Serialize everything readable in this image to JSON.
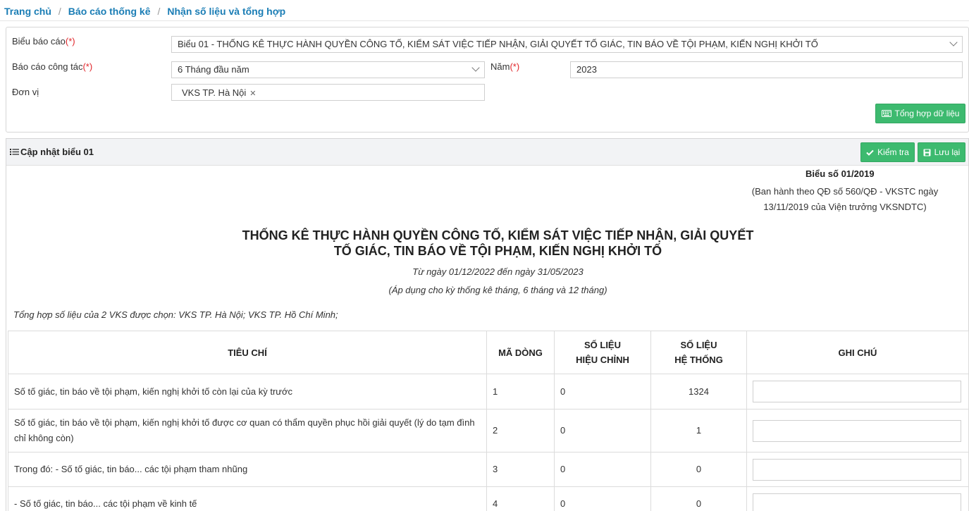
{
  "breadcrumb": [
    "Trang chủ",
    "Báo cáo thống kê",
    "Nhận số liệu và tổng hợp"
  ],
  "filters": {
    "report_form_label": "Biểu báo cáo",
    "required_mark": "(*)",
    "report_form_value": "Biểu 01 - THỐNG KÊ THỰC HÀNH QUYỀN CÔNG TỐ, KIỂM SÁT VIỆC TIẾP NHẬN, GIẢI QUYẾT TỐ GIÁC, TIN BÁO VỀ TỘI PHẠM, KIẾN NGHỊ KHỞI TỐ",
    "period_label": "Báo cáo công tác",
    "period_value": "6 Tháng đầu năm",
    "year_label": "Năm",
    "year_value": "2023",
    "unit_label": "Đơn vị",
    "unit_tags": [
      "VKS TP. Hà Nội"
    ],
    "aggregate_button": "Tổng hợp dữ liệu"
  },
  "update_panel": {
    "title": "Cập nhật biểu 01",
    "check_button": "Kiểm tra",
    "save_button": "Lưu lại"
  },
  "report": {
    "form_no": "Biểu số 01/2019",
    "issued_line1": "(Ban hành theo QĐ số 560/QĐ - VKSTC ngày",
    "issued_line2": "13/11/2019 của Viện trưởng VKSNDTC)",
    "title_line1": "THỐNG KÊ THỰC HÀNH QUYỀN CÔNG TỐ, KIỂM SÁT VIỆC TIẾP NHẬN, GIẢI QUYẾT",
    "title_line2": "TỐ GIÁC, TIN BÁO VỀ TỘI PHẠM, KIẾN NGHỊ KHỞI TỐ",
    "period": "Từ ngày 01/12/2022 đến ngày 31/05/2023",
    "apply": "(Áp dụng cho kỳ thống kê tháng, 6 tháng và 12 tháng)",
    "summary": "Tổng hợp số liệu của 2 VKS được chọn: VKS TP. Hà Nội; VKS TP. Hồ Chí Minh;"
  },
  "table": {
    "headers": {
      "criteria": "TIÊU CHÍ",
      "row_code": "MÃ DÒNG",
      "adjusted_1": "SỐ LIỆU",
      "adjusted_2": "HIỆU CHỈNH",
      "system_1": "SỐ LIỆU",
      "system_2": "HỆ THỐNG",
      "note": "GHI CHÚ"
    },
    "rows": [
      {
        "criteria": "Số tố giác, tin báo về tội phạm, kiến nghị khởi tố còn lại của kỳ trước",
        "code": "1",
        "adjusted": "0",
        "system": "1324",
        "note": ""
      },
      {
        "criteria": "Số tố giác, tin báo về tội phạm, kiến nghị khởi tố được cơ quan có thẩm quyền phục hồi giải quyết (lý do tạm đình chỉ không còn)",
        "code": "2",
        "adjusted": "0",
        "system": "1",
        "note": ""
      },
      {
        "criteria": "Trong đó: - Số tố giác, tin báo... các tội phạm tham nhũng",
        "code": "3",
        "adjusted": "0",
        "system": "0",
        "note": ""
      },
      {
        "criteria": "- Số tố giác, tin báo... các tội phạm về kinh tế",
        "code": "4",
        "adjusted": "0",
        "system": "0",
        "note": ""
      }
    ]
  }
}
